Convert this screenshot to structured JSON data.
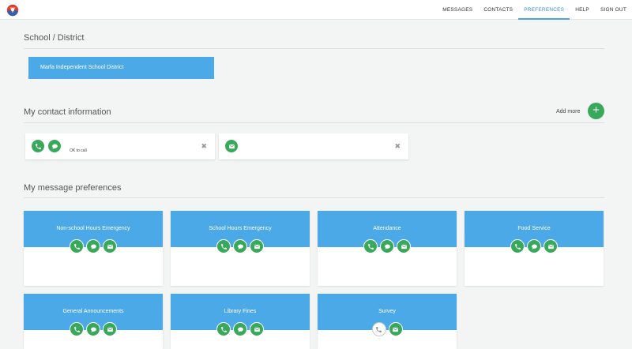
{
  "colors": {
    "accent": "#4aa9e6",
    "green": "#39a85a",
    "nav_active": "#3b8fd6"
  },
  "nav": {
    "logo_icon": "app-logo",
    "items": [
      {
        "label": "MESSAGES",
        "active": false
      },
      {
        "label": "CONTACTS",
        "active": false
      },
      {
        "label": "PREFERENCES",
        "active": true
      },
      {
        "label": "HELP",
        "active": false
      },
      {
        "label": "SIGN OUT",
        "active": false
      }
    ]
  },
  "school": {
    "title": "School / District",
    "district": "Marfa Independent School District"
  },
  "contact": {
    "title": "My contact information",
    "add_more": "Add more",
    "add_icon": "plus-icon",
    "cards": [
      {
        "icons": [
          "phone-icon",
          "chat-icon"
        ],
        "note": "OK to call",
        "remove_icon": "close-icon"
      },
      {
        "icons": [
          "email-icon"
        ],
        "note": "",
        "remove_icon": "close-icon"
      }
    ]
  },
  "preferences": {
    "title": "My message preferences",
    "cards": [
      {
        "label": "Non-school Hours Emergency",
        "icons": [
          "phone-icon",
          "chat-icon",
          "email-icon"
        ]
      },
      {
        "label": "School Hours Emergency",
        "icons": [
          "phone-icon",
          "chat-icon",
          "email-icon"
        ]
      },
      {
        "label": "Attendance",
        "icons": [
          "phone-icon",
          "chat-icon",
          "email-icon"
        ]
      },
      {
        "label": "Food Service",
        "icons": [
          "phone-icon",
          "chat-icon",
          "email-icon"
        ]
      },
      {
        "label": "General Announcements",
        "icons": [
          "phone-icon",
          "chat-icon",
          "email-icon"
        ]
      },
      {
        "label": "Library Fines",
        "icons": [
          "phone-icon",
          "chat-icon",
          "email-icon"
        ]
      },
      {
        "label": "Survey",
        "icons": [
          "phone-icon-off",
          "email-icon"
        ]
      }
    ]
  }
}
